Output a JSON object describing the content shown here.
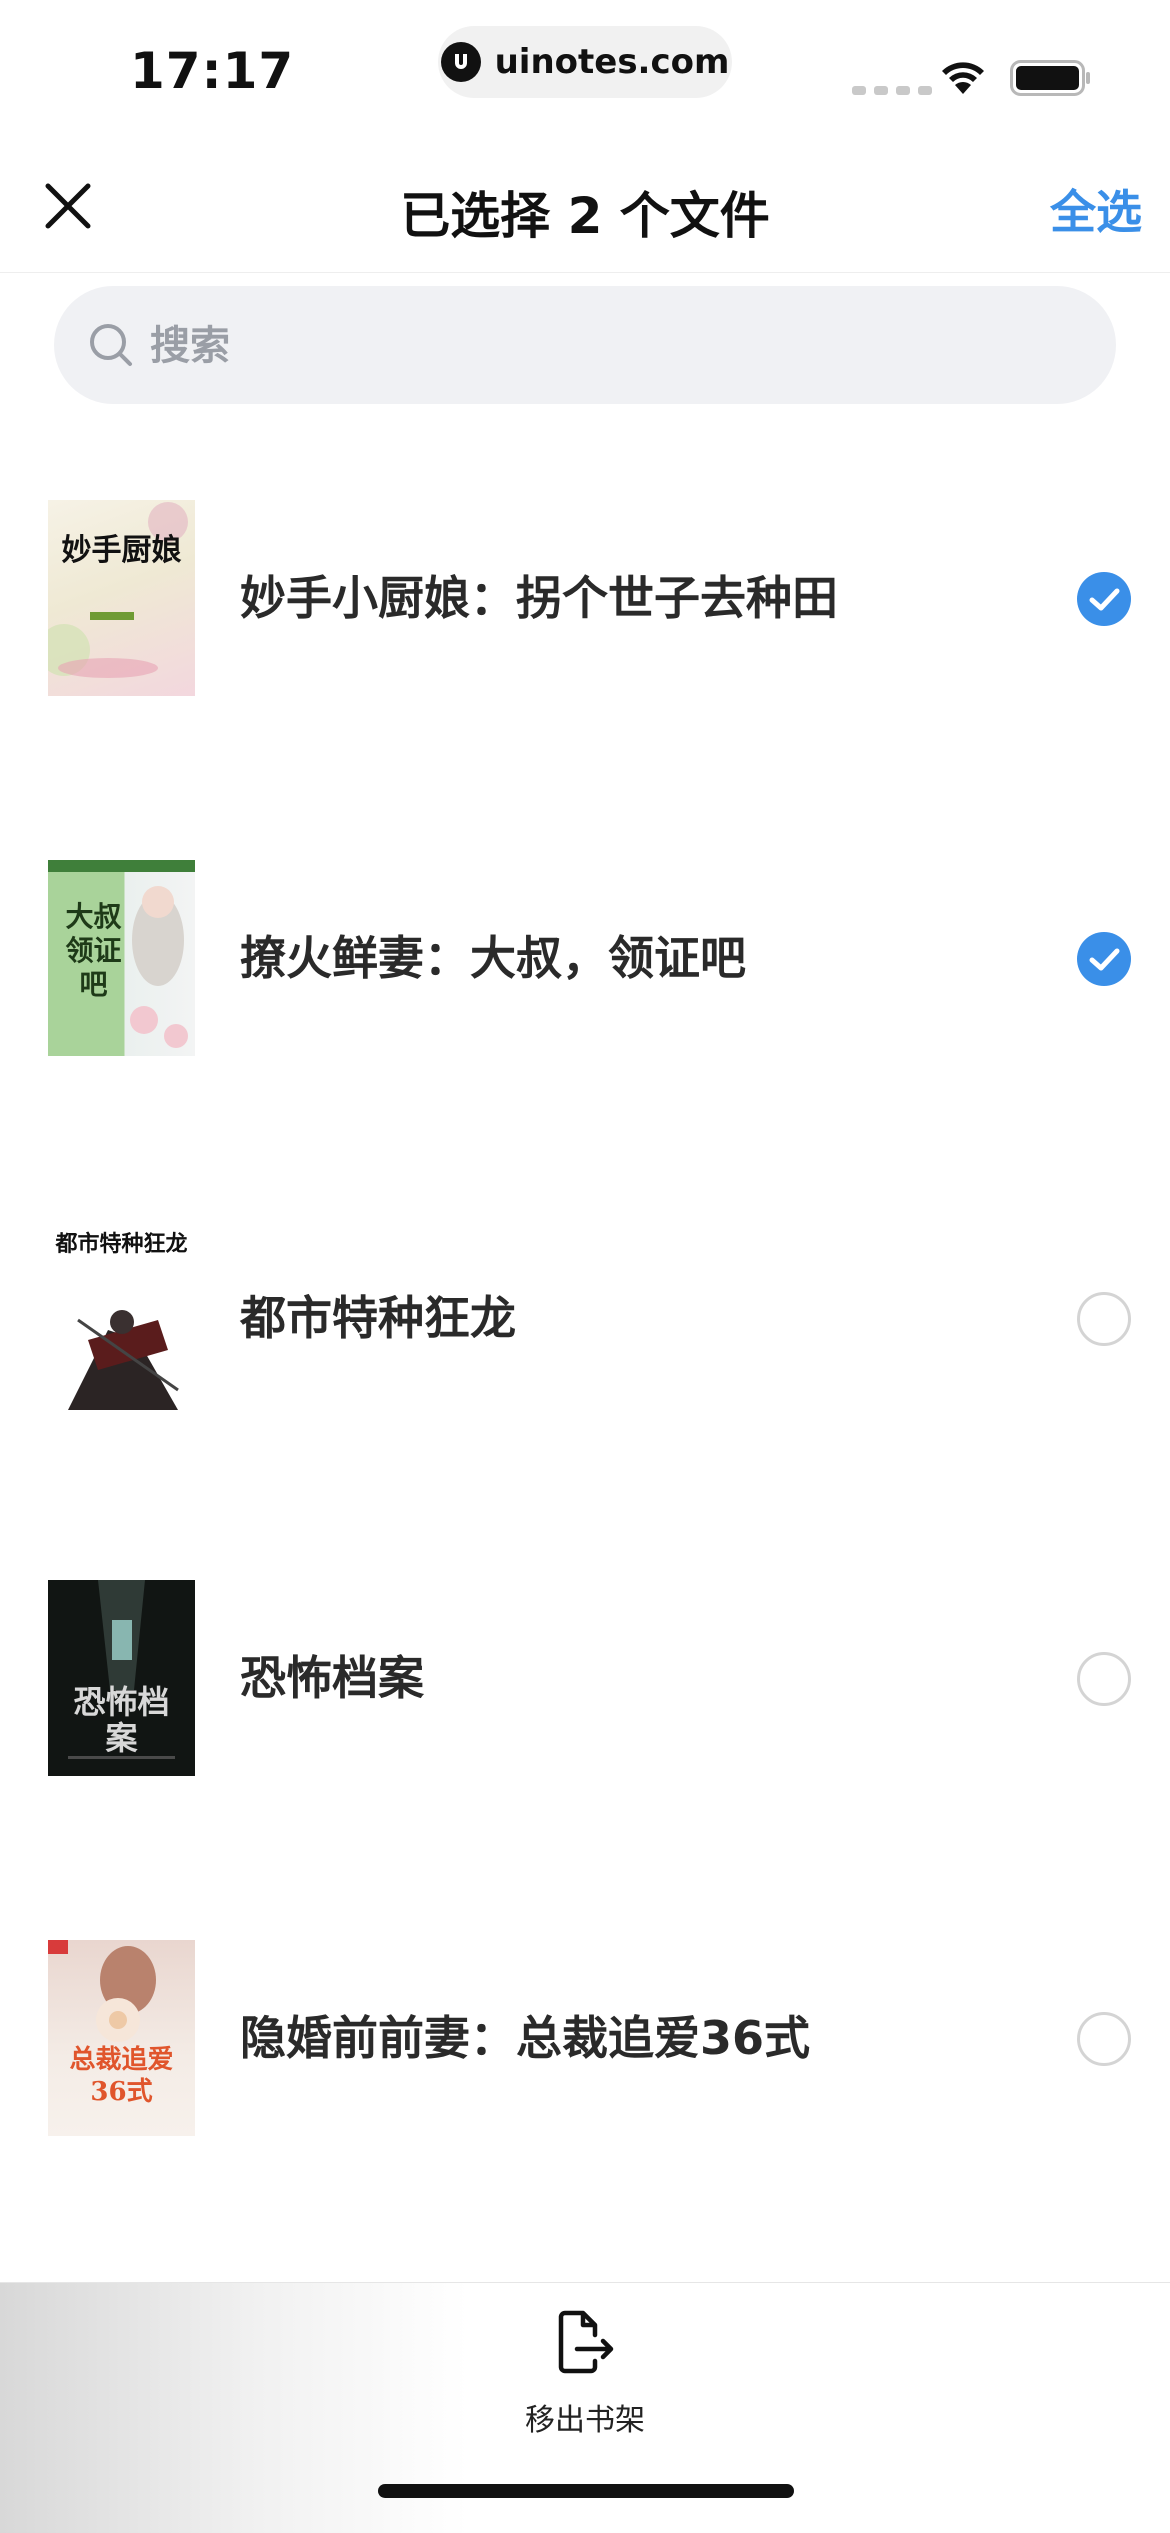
{
  "status_bar": {
    "time": "17:17",
    "url": "uinotes.com"
  },
  "header": {
    "title": "已选择 2 个文件",
    "select_all": "全选"
  },
  "search": {
    "placeholder": "搜索",
    "value": ""
  },
  "books": [
    {
      "title": "妙手小厨娘：拐个世子去种田",
      "selected": true,
      "cover_text": "妙手厨娘"
    },
    {
      "title": "撩火鲜妻：大叔，领证吧",
      "selected": true,
      "cover_text": "大叔领证吧"
    },
    {
      "title": "都市特种狂龙",
      "selected": false,
      "cover_text": "都市特种狂龙"
    },
    {
      "title": "恐怖档案",
      "selected": false,
      "cover_text": "恐怖档案"
    },
    {
      "title": "隐婚前前妻：总裁追爱36式",
      "selected": false,
      "cover_text": "总裁追爱36式"
    }
  ],
  "bottom_bar": {
    "remove_label": "移出书架"
  },
  "colors": {
    "accent": "#3a8fe8",
    "unchecked": "#d4d4d4",
    "search_bg": "#f0f1f4"
  }
}
